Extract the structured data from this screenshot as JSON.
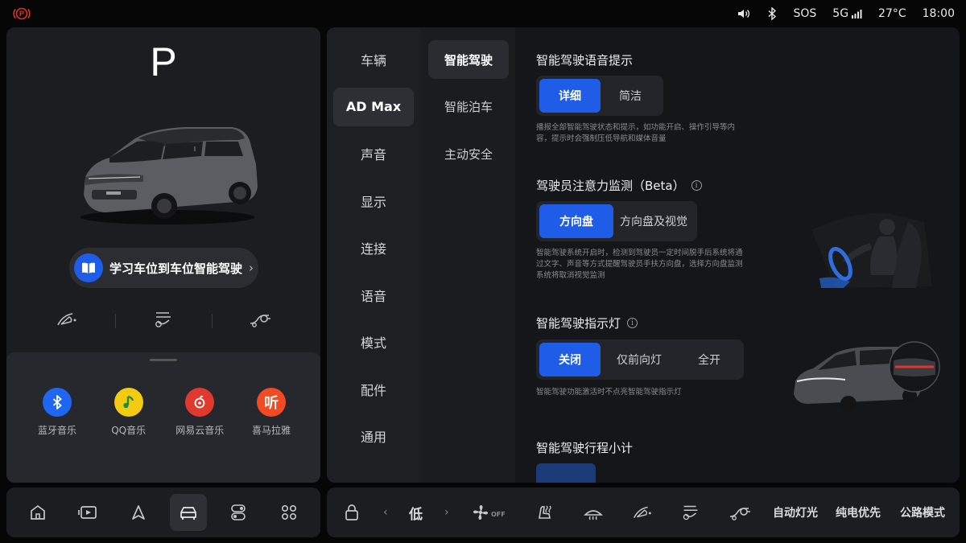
{
  "status": {
    "volume_icon": "volume-icon",
    "bluetooth_icon": "bluetooth-icon",
    "sos": "SOS",
    "network": "5G",
    "temperature": "27°C",
    "time": "18:00"
  },
  "vehicle": {
    "gear": "P",
    "learn_label": "学习车位到车位智能驾驶"
  },
  "media": {
    "apps": [
      {
        "name": "蓝牙音乐",
        "icon": "bluetooth-music-icon",
        "color": "#1f66f2"
      },
      {
        "name": "QQ音乐",
        "icon": "qq-music-icon",
        "color": "#f2cb12"
      },
      {
        "name": "网易云音乐",
        "icon": "netease-music-icon",
        "color": "#e03a2f"
      },
      {
        "name": "喜马拉雅",
        "icon": "ximalaya-icon",
        "color": "#f24a22",
        "glyph": "听"
      }
    ]
  },
  "settings": {
    "categories": [
      "车辆",
      "AD Max",
      "声音",
      "显示",
      "连接",
      "语音",
      "模式",
      "配件",
      "通用"
    ],
    "active_category": 1,
    "subcategories": [
      "智能驾驶",
      "智能泊车",
      "主动安全"
    ],
    "active_sub": 0,
    "sections": [
      {
        "title": "智能驾驶语音提示",
        "options": [
          "详细",
          "简洁"
        ],
        "selected": 0,
        "desc": "播报全部智能驾驶状态和提示，如功能开启、操作引导等内容，提示时会强制压低导航和媒体音量"
      },
      {
        "title": "驾驶员注意力监测（Beta）",
        "options": [
          "方向盘",
          "方向盘及视觉"
        ],
        "selected": 0,
        "desc": "智能驾驶系统开启时，检测到驾驶员一定时间脱手后系统将通过文字、声音等方式提醒驾驶员手扶方向盘，选择方向盘监测系统将取消视觉监测"
      },
      {
        "title": "智能驾驶指示灯",
        "options": [
          "关闭",
          "仅前向灯",
          "全开"
        ],
        "selected": 0,
        "desc": "智能驾驶功能激活时不点亮智能驾驶指示灯"
      },
      {
        "title": "智能驾驶行程小计"
      }
    ]
  },
  "controls": {
    "fan_level": "低",
    "fan_status": "OFF",
    "auto_lights": "自动灯光",
    "ev_priority": "纯电优先",
    "road_mode": "公路模式"
  },
  "colors": {
    "accent": "#1f5ce8",
    "panel": "#1c1d21",
    "background": "#060607",
    "park_red": "#e0322d"
  }
}
